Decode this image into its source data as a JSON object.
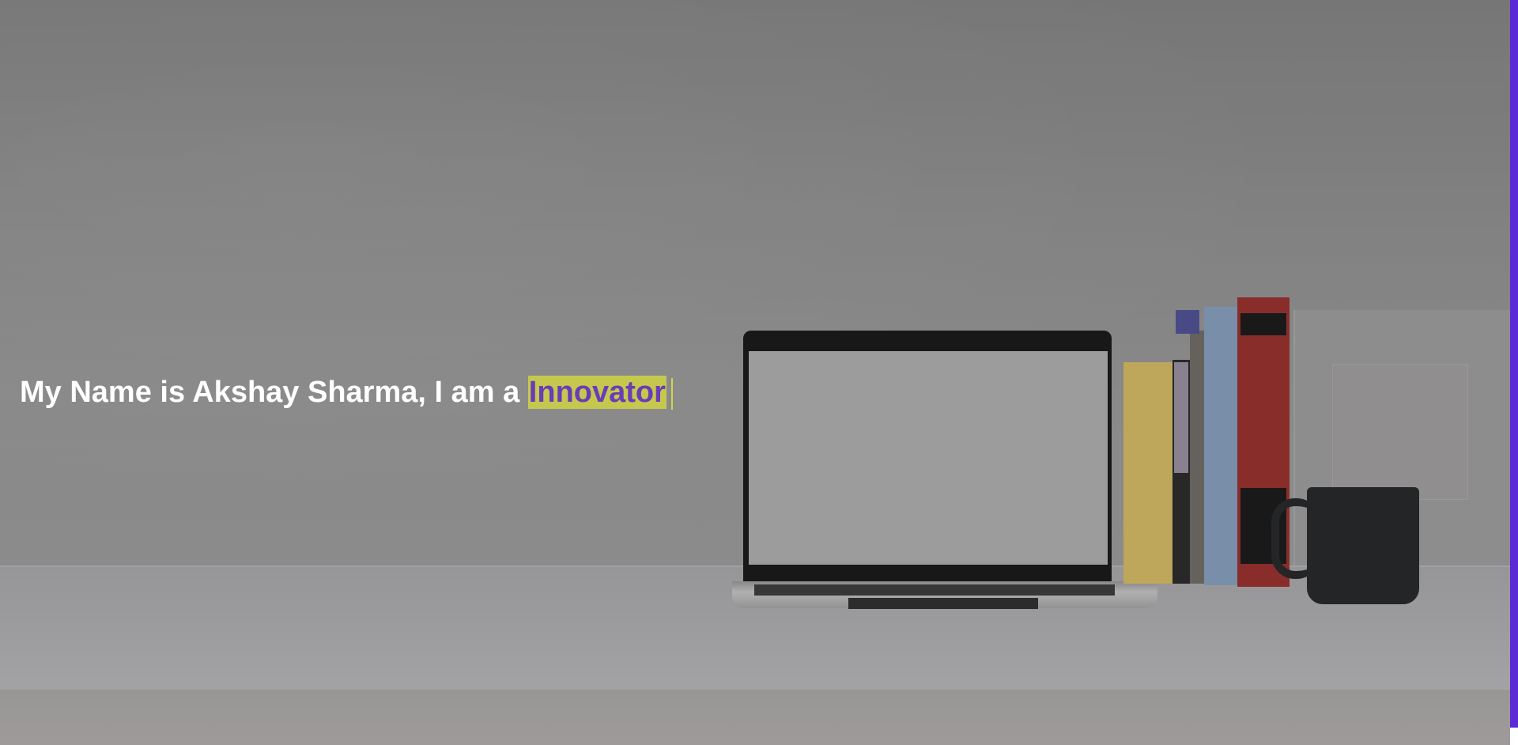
{
  "hero": {
    "intro_text": "My Name is Akshay Sharma, I am a ",
    "typed_word": "Innovator"
  },
  "colors": {
    "headline": "#ffffff",
    "typed_highlight_bg": "#c5c84f",
    "typed_text": "#6a3cb7",
    "scrollbar_thumb": "#5b2bd6"
  }
}
